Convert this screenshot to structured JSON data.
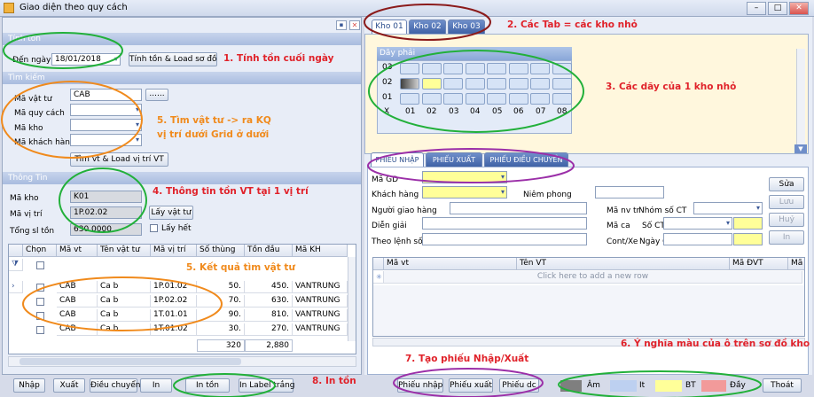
{
  "window": {
    "title": "Giao diện theo quy cách",
    "btn_min": "–",
    "btn_max": "□",
    "btn_close": "✕"
  },
  "left": {
    "pin": "▪",
    "close": "✕",
    "tinh_ton": {
      "header": "Tính tồn",
      "den_ngay_label": "Đến ngày",
      "den_ngay_value": "18/01/2018",
      "button": "Tính tồn & Load sơ đồ"
    },
    "tim_kiem": {
      "header": "Tìm kiếm",
      "ma_vat_tu_label": "Mã vật tư",
      "ma_vat_tu_value": "CAB",
      "ellipsis": "......",
      "ma_quy_cach_label": "Mã quy cách",
      "ma_kho_label": "Mã kho",
      "ma_khach_hang_label": "Mã khách hàng",
      "button": "Tìm vt & Load vị trí VT"
    },
    "thong_tin": {
      "header": "Thông Tin",
      "ma_kho_label": "Mã kho",
      "ma_kho_value": "K01",
      "ma_vi_tri_label": "Mã vị trí",
      "ma_vi_tri_value": "1P.02.02",
      "lay_vat_tu": "Lấy vật tư",
      "tong_sl_ton_label": "Tổng sl tồn",
      "tong_sl_ton_value": "630.0000",
      "lay_het": "Lấy hết"
    },
    "grid": {
      "columns": [
        "Chọn",
        "Mã vt",
        "Tên vật tư",
        "Mã vị trí",
        "Số thùng",
        "Tồn đầu",
        "Mã KH"
      ],
      "rows": [
        [
          "CAB",
          "Ca b",
          "1P.01.02",
          "50.",
          "450.",
          "VANTRUNG"
        ],
        [
          "CAB",
          "Ca b",
          "1P.02.02",
          "70.",
          "630.",
          "VANTRUNG"
        ],
        [
          "CAB",
          "Ca b",
          "1T.01.01",
          "90.",
          "810.",
          "VANTRUNG"
        ],
        [
          "CAB",
          "Ca b",
          "1T.01.02",
          "30.",
          "270.",
          "VANTRUNG"
        ]
      ],
      "footer_so_thung": "320",
      "footer_ton_dau": "2,880"
    },
    "buttons": [
      "Nhập",
      "Xuất",
      "Điều chuyển",
      "In",
      "In tồn",
      "In Label trắng"
    ]
  },
  "right": {
    "tabs": [
      "Kho 01",
      "Kho 02",
      "Kho 03"
    ],
    "day_phai": "Dãy phải",
    "row_labels": [
      "03",
      "02",
      "01"
    ],
    "x_label": "X",
    "col_labels": [
      "01",
      "02",
      "03",
      "04",
      "05",
      "06",
      "07",
      "08"
    ],
    "phieu_tabs": [
      "PHIẾU NHẬP",
      "PHIẾU XUẤT",
      "PHIẾU ĐIỀU CHUYỂN"
    ],
    "form": {
      "ma_gd": "Mã GD",
      "khach_hang": "Khách hàng",
      "niem_phong": "Niêm phong",
      "nguoi_giao_hang": "Người giao hàng",
      "ma_nv": "Mã nv tr",
      "nhom_so_ct": "Nhóm số CT",
      "dien_giai": "Diễn giải",
      "ma_ca": "Mã  ca",
      "so_ct": "Số CT",
      "theo_lenh_so": "Theo lệnh số",
      "cont_xe": "Cont/Xe",
      "ngay_c": "Ngày C",
      "side_buttons": [
        "Sửa",
        "Lưu",
        "Huỷ",
        "In"
      ]
    },
    "grid2": {
      "columns": [
        "Mã vt",
        "Tên VT",
        "Mã ĐVT",
        "Mã KH"
      ],
      "add_row": "Click here to add a new row"
    }
  },
  "bottom": {
    "phieu_nhap": "Phiếu nhập",
    "phieu_xuat": "Phiếu xuất",
    "phieu_dc": "Phiếu dc",
    "legend": [
      "Âm",
      "It",
      "BT",
      "Đầy"
    ],
    "thoat": "Thoát",
    "legend_colors": [
      "#7f7f7f",
      "#bdd0f0",
      "#ffff99",
      "#f29a9a"
    ]
  },
  "annotations": {
    "a1": "1. Tính tồn cuối ngày",
    "a2": "2. Các Tab = các kho nhỏ",
    "a3": "3. Các dãy của 1 kho nhỏ",
    "a4": "4. Thông tin tồn VT tại 1 vị trí",
    "a5a": "5. Tìm vật tư -> ra KQ",
    "a5b": "vị trí dưới Grid ở dưới",
    "a5c": "5. Kết quả tìm vật tư",
    "a6": "6. Ý nghĩa màu của ô trên sơ đồ kho",
    "a7": "7. Tạo phiếu Nhập/Xuất",
    "a8": "8. In tồn"
  }
}
